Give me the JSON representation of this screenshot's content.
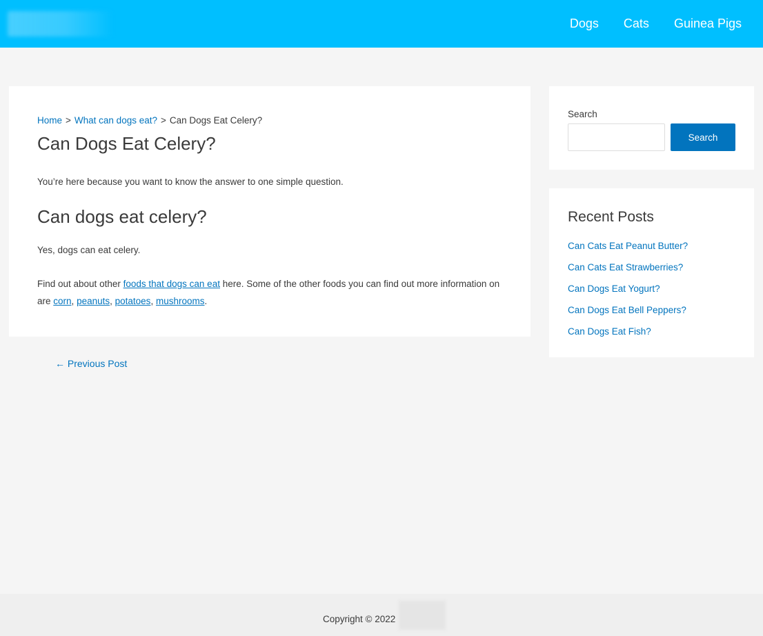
{
  "header": {
    "nav": [
      {
        "label": "Dogs"
      },
      {
        "label": "Cats"
      },
      {
        "label": "Guinea Pigs"
      }
    ]
  },
  "article": {
    "breadcrumb": {
      "home": "Home",
      "sep": ">",
      "category": "What can dogs eat?",
      "current": "Can Dogs Eat Celery?"
    },
    "title": "Can Dogs Eat Celery?",
    "intro": "You’re here because you want to know the answer to one simple question.",
    "subheading": "Can dogs eat celery?",
    "answer": "Yes, dogs can eat celery.",
    "more_info": {
      "before": "Find out about other ",
      "link_foods": "foods that dogs can eat",
      "middle": " here. Some of the other foods you can find out more information on are ",
      "link_corn": "corn",
      "link_peanuts": "peanuts",
      "link_potatoes": "potatoes",
      "link_mushrooms": "mushrooms",
      "comma": ",",
      "end": "."
    }
  },
  "post_nav": {
    "previous": "← Previous Post"
  },
  "sidebar": {
    "search": {
      "label": "Search",
      "placeholder": "",
      "button": "Search"
    },
    "recent": {
      "title": "Recent Posts",
      "items": [
        "Can Cats Eat Peanut Butter?",
        "Can Cats Eat Strawberries?",
        "Can Dogs Eat Yogurt?",
        "Can Dogs Eat Bell Peppers?",
        "Can Dogs Eat Fish?"
      ]
    }
  },
  "footer": {
    "copyright": "Copyright © 2022"
  },
  "colors": {
    "header_bg": "#00bfff",
    "link": "#0274be",
    "page_bg": "#f5f5f5"
  }
}
